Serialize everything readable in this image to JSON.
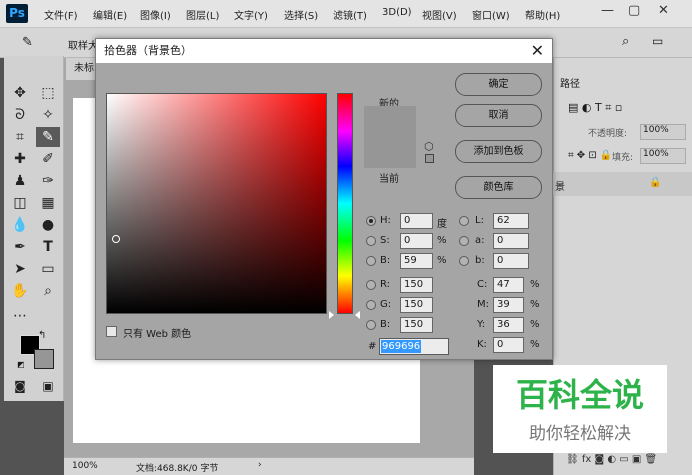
{
  "app": {
    "logo": "Ps",
    "menu": [
      "文件(F)",
      "编辑(E)",
      "图像(I)",
      "图层(L)",
      "文字(Y)",
      "选择(S)",
      "滤镜(T)",
      "3D(D)",
      "视图(V)",
      "窗口(W)",
      "帮助(H)"
    ],
    "window_controls": {
      "minimize": "—",
      "restore": "▢",
      "close": "✕"
    }
  },
  "options_bar": {
    "sample_label": "取样大"
  },
  "document": {
    "tab_label": "未标",
    "zoom": "100%",
    "status": "文档:468.8K/0 字节"
  },
  "right_panel": {
    "paths_tab": "路径",
    "opacity_label": "不透明度:",
    "opacity_value": "100%",
    "fill_label": "填充:",
    "fill_value": "100%",
    "background_layer_label": "景"
  },
  "dialog": {
    "title": "拾色器（背景色）",
    "close": "✕",
    "new_label": "新的",
    "current_label": "当前",
    "buttons": {
      "ok": "确定",
      "cancel": "取消",
      "add_to_swatches": "添加到色板",
      "color_libraries": "颜色库"
    },
    "web_only_label": "只有 Web 颜色",
    "fields": {
      "H": {
        "label": "H:",
        "value": "0",
        "unit": "度"
      },
      "S": {
        "label": "S:",
        "value": "0",
        "unit": "%"
      },
      "B": {
        "label": "B:",
        "value": "59",
        "unit": "%"
      },
      "R": {
        "label": "R:",
        "value": "150"
      },
      "G": {
        "label": "G:",
        "value": "150"
      },
      "Bl": {
        "label": "B:",
        "value": "150"
      },
      "L": {
        "label": "L:",
        "value": "62"
      },
      "a": {
        "label": "a:",
        "value": "0"
      },
      "b": {
        "label": "b:",
        "value": "0"
      },
      "C": {
        "label": "C:",
        "value": "47",
        "unit": "%"
      },
      "M": {
        "label": "M:",
        "value": "39",
        "unit": "%"
      },
      "Y": {
        "label": "Y:",
        "value": "36",
        "unit": "%"
      },
      "K": {
        "label": "K:",
        "value": "0",
        "unit": "%"
      }
    },
    "hex_label": "#",
    "hex_value": "969696",
    "colors": {
      "selected": "#969696"
    }
  },
  "watermark": {
    "title": "百科全说",
    "subtitle": "助你轻松解决"
  }
}
